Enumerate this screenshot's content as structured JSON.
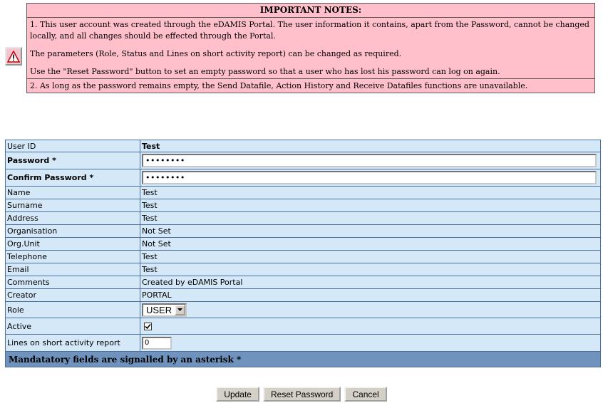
{
  "notes": {
    "title": "IMPORTANT NOTES:",
    "note1_p1": "1. This user account was created through the eDAMIS Portal. The user information it contains, apart from the Password, cannot be changed locally, and all changes should be effected through the Portal.",
    "note1_p2": "The parameters (Role, Status and Lines on short activity report) can be changed as required.",
    "note1_p3": "Use the \"Reset Password\" button to set an empty password so that a user who has lost his password can log on again.",
    "note2": "2. As long as the password remains empty, the Send Datafile, Action History and Receive Datafiles functions are unavailable."
  },
  "form": {
    "user_id": {
      "label": "User ID",
      "value": "Test"
    },
    "password": {
      "label": "Password *",
      "value": "••••••••"
    },
    "confirm_password": {
      "label": "Confirm Password *",
      "value": "••••••••"
    },
    "name": {
      "label": "Name",
      "value": "Test"
    },
    "surname": {
      "label": "Surname",
      "value": "Test"
    },
    "address": {
      "label": "Address",
      "value": "Test"
    },
    "organisation": {
      "label": "Organisation",
      "value": "Not Set"
    },
    "org_unit": {
      "label": "Org.Unit",
      "value": "Not Set"
    },
    "telephone": {
      "label": "Telephone",
      "value": "Test"
    },
    "email": {
      "label": "Email",
      "value": "Test"
    },
    "comments": {
      "label": "Comments",
      "value": "Created by eDAMIS Portal"
    },
    "creator": {
      "label": "Creator",
      "value": "PORTAL"
    },
    "role": {
      "label": "Role",
      "value": "USER"
    },
    "active": {
      "label": "Active",
      "checked": true
    },
    "lines": {
      "label": "Lines on short activity report",
      "value": "0"
    },
    "mandatory_note": "Mandatatory fields are signalled by an asterisk *"
  },
  "buttons": {
    "update": "Update",
    "reset_password": "Reset Password",
    "cancel": "Cancel"
  },
  "icons": {
    "warning": "warning-triangle-icon",
    "dropdown": "chevron-down-icon",
    "checkbox": "checkmark-icon"
  },
  "colors": {
    "notes_bg": "#ffc0cb",
    "form_bg": "#d4e8f8",
    "form_border": "#4a6f9a",
    "mandatory_bg": "#6f93bd"
  }
}
